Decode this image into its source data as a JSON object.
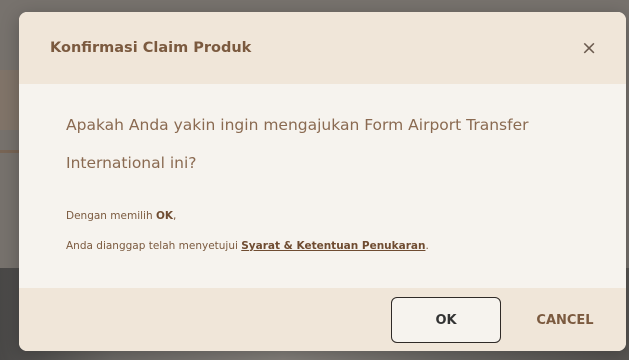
{
  "modal": {
    "title": "Konfirmasi Claim Produk",
    "close_symbol": "×",
    "question": "Apakah Anda yakin ingin mengajukan Form Airport Transfer International ini?",
    "note_prefix": "Dengan memilih ",
    "note_ok": "OK",
    "note_suffix": ",",
    "agreement_prefix": "Anda dianggap telah menyetujui ",
    "terms_link": "Syarat & Ketentuan Penukaran",
    "agreement_suffix": ".",
    "ok_label": "OK",
    "cancel_label": "CANCEL"
  },
  "icons": {
    "close": "close-icon"
  },
  "colors": {
    "brand_brown": "#7b5a3f",
    "header_bg": "#f0e6d9",
    "body_bg": "#f6f3ee"
  }
}
